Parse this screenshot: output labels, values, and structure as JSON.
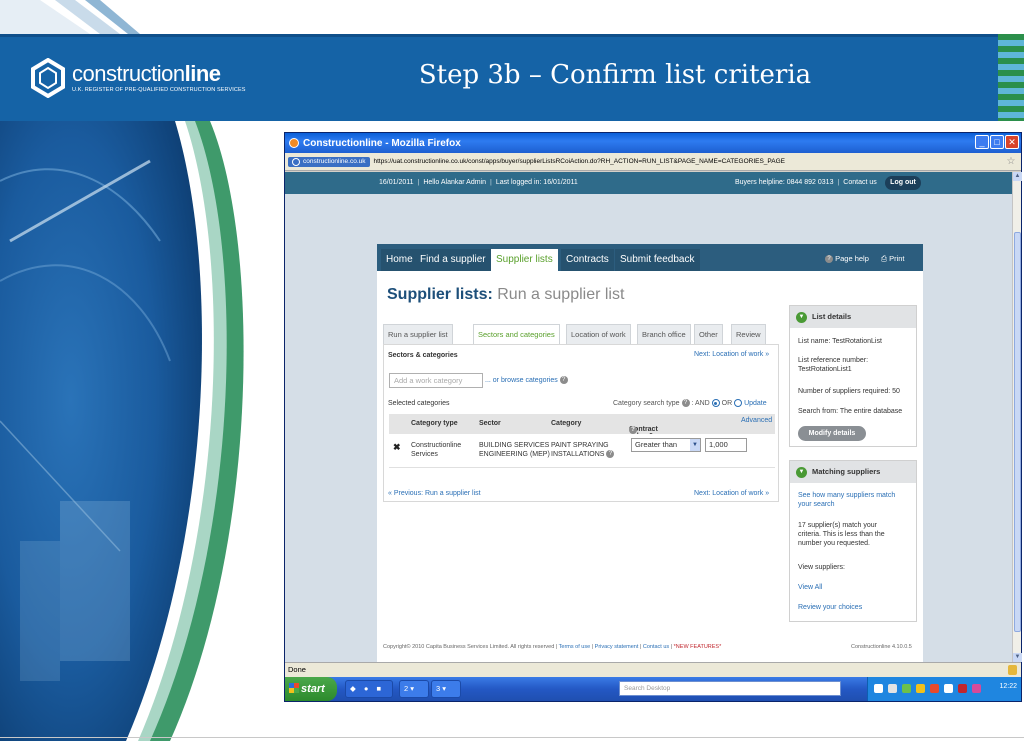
{
  "slide": {
    "logo_word": "construction",
    "logo_word_bold": "line",
    "logo_tagline": "U.K. REGISTER OF PRE-QUALIFIED CONSTRUCTION SERVICES",
    "title": "Step 3b – Confirm list criteria"
  },
  "browser": {
    "window_title": "Constructionline - Mozilla Firefox",
    "site_badge": "constructionline.co.uk",
    "url": "https://uat.constructionline.co.uk/const/apps/buyer/supplierListsRCoiAction.do?RH_ACTION=RUN_LIST&PAGE_NAME=CATEGORIES_PAGE",
    "status": "Done"
  },
  "topbar": {
    "date": "16/01/2011",
    "greeting": "Hello Alankar Admin",
    "last_logged": "Last logged in: 16/01/2011",
    "helpline": "Buyers helpline: 0844 892 0313",
    "contact": "Contact us",
    "logout": "Log out"
  },
  "nav": {
    "items": [
      "Home",
      "Find a supplier",
      "Supplier lists",
      "Contracts",
      "Submit feedback"
    ],
    "active_index": 2,
    "page_help": "Page help",
    "print": "Print"
  },
  "heading": {
    "main": "Supplier lists:",
    "sub": "Run a supplier list"
  },
  "tabs": [
    "Run a supplier list",
    "Sectors and categories",
    "Location of work",
    "Branch office",
    "Other",
    "Review"
  ],
  "form": {
    "section_title": "Sectors & categories",
    "next_link": "Next: Location of work »",
    "work_category_placeholder": "Add a work category",
    "browse_link": "... or browse categories",
    "selected_label": "Selected categories",
    "search_type_label": "Category search type",
    "and_label": ": AND",
    "or_label": "OR",
    "update_link": "Update",
    "advanced_link": "Advanced",
    "prev_link": "« Previous: Run a supplier list",
    "next_link_bottom": "Next: Location of work »"
  },
  "table": {
    "headers": [
      "Category type",
      "Sector",
      "Category",
      "Contract value £"
    ],
    "rows": [
      {
        "type_line1": "Constructionline",
        "type_line2": "Services",
        "sector_line1": "BUILDING SERVICES",
        "sector_line2": "ENGINEERING (MEP)",
        "category_line1": "PAINT SPRAYING",
        "category_line2": "INSTALLATIONS",
        "operator": "Greater than",
        "value": "1,000"
      }
    ]
  },
  "list_details": {
    "title": "List details",
    "name": "List name: TestRotationList",
    "ref_label": "List reference number:",
    "ref_value": "TestRotationList1",
    "suppliers_required": "Number of suppliers required: 50",
    "search_from": "Search from: The entire database",
    "modify": "Modify details"
  },
  "matching": {
    "title": "Matching suppliers",
    "see_how_1": "See how many suppliers match",
    "see_how_2": "your search",
    "match_1": "17 supplier(s) match your",
    "match_2": "criteria. This is less than the",
    "match_3": "number you requested.",
    "view_label": "View suppliers:",
    "view_all": "View All",
    "review": "Review your choices"
  },
  "footer": {
    "copyright": "Copyright© 2010 Capita Business Services Limited. All rights reserved",
    "terms": "Terms of use",
    "privacy": "Privacy statement",
    "contact": "Contact us",
    "new_features": "*NEW FEATURES*",
    "version": "Constructionline 4.10.0.5"
  },
  "taskbar": {
    "start": "start",
    "task1": "2 ▾",
    "task2": "3 ▾",
    "search_placeholder": "Search Desktop",
    "clock": "12:22"
  },
  "colors": {
    "banner": "#1563a6",
    "nav": "#2c5d7e",
    "accent_green": "#5aa02c",
    "link": "#2a6fb5"
  }
}
